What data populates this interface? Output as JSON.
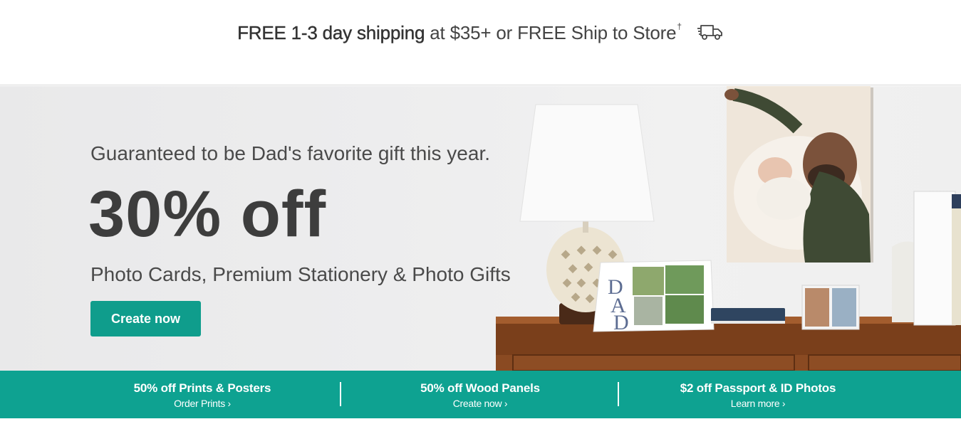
{
  "shipping": {
    "bold_text": "FREE 1-3 day shipping",
    "rest_text": " at $35+ or FREE Ship to Store",
    "footnote_mark": "†",
    "icon": "truck-icon"
  },
  "hero": {
    "tagline": "Guaranteed to be Dad's favorite gift this year.",
    "headline": "30% off",
    "subline": "Photo Cards, Premium Stationery & Photo Gifts",
    "cta_label": "Create now",
    "card_text": "DAD"
  },
  "promos": [
    {
      "title": "50% off Prints & Posters",
      "link": "Order Prints ›"
    },
    {
      "title": "50% off Wood Panels",
      "link": "Create now ›"
    },
    {
      "title": "$2 off Passport & ID Photos",
      "link": "Learn more ›"
    }
  ],
  "colors": {
    "accent": "#0f9d8c",
    "promo_bg": "#0ea291",
    "headline": "#3d3d3d"
  }
}
